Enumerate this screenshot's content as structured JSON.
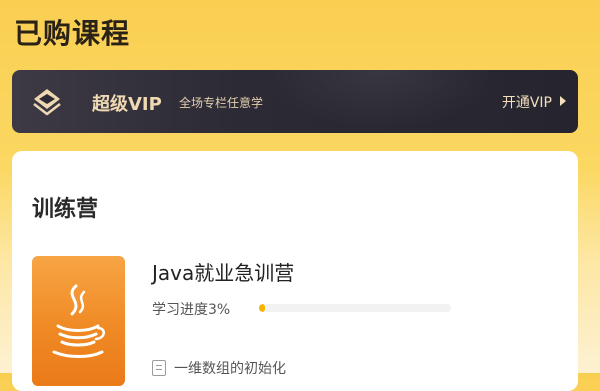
{
  "header": {
    "title": "已购课程"
  },
  "vip_banner": {
    "title": "超级VIP",
    "subtitle": "全场专栏任意学",
    "cta": "开通VIP",
    "icon": "vip-diamond-icon"
  },
  "section": {
    "title": "训练营",
    "course": {
      "title": "Java就业急训营",
      "progress_label": "学习进度3%",
      "progress": 0.03,
      "thumbnail_icon": "java-coffee-cup-icon",
      "lesson": "一维数组的初始化"
    }
  },
  "colors": {
    "page_background": "#f9cf52",
    "vip_banner": "#2c2a34",
    "vip_text": "#efd9b2",
    "thumbnail": "#f08a24",
    "progress_fill": "#f5b400"
  }
}
